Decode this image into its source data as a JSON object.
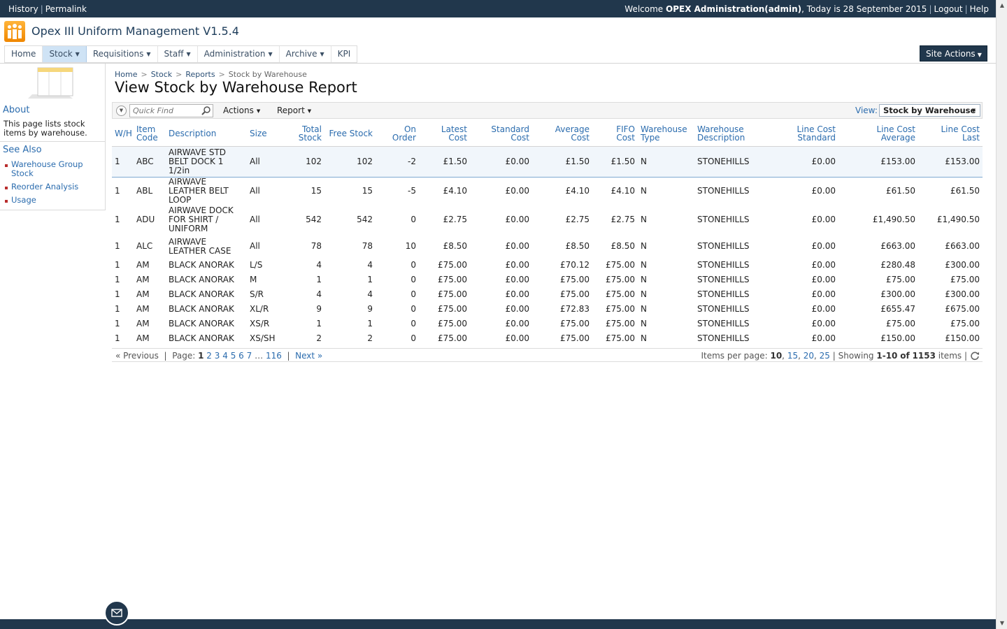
{
  "topbar": {
    "history": "History",
    "permalink": "Permalink",
    "welcome_prefix": "Welcome",
    "user": "OPEX Administration(admin)",
    "today": ", Today is 28 September 2015",
    "logout": "Logout",
    "help": "Help"
  },
  "app": {
    "title": "Opex III Uniform Management V1.5.4"
  },
  "nav": {
    "home": "Home",
    "stock": "Stock",
    "requisitions": "Requisitions",
    "staff": "Staff",
    "administration": "Administration",
    "archive": "Archive",
    "kpi": "KPI",
    "site_actions": "Site Actions"
  },
  "sidebar": {
    "about_title": "About",
    "about_text": "This page lists stock items by warehouse.",
    "see_also_title": "See Also",
    "links": [
      "Warehouse Group Stock",
      "Reorder Analysis",
      "Usage"
    ]
  },
  "breadcrumb": {
    "home": "Home",
    "stock": "Stock",
    "reports": "Reports",
    "current": "Stock by Warehouse"
  },
  "page": {
    "title": "View Stock by Warehouse Report"
  },
  "toolbar": {
    "quick_find_placeholder": "Quick Find",
    "actions": "Actions",
    "report": "Report",
    "view_label": "View:",
    "view_value": "Stock by Warehouse"
  },
  "table": {
    "headers": [
      "W/H",
      "Item Code",
      "Description",
      "Size",
      "Total Stock",
      "Free Stock",
      "On Order",
      "Latest Cost",
      "Standard Cost",
      "Average Cost",
      "FIFO Cost",
      "Warehouse Type",
      "Warehouse Description",
      "Line Cost Standard",
      "Line Cost Average",
      "Line Cost Last"
    ],
    "rows": [
      [
        "1",
        "ABC",
        "AIRWAVE STD BELT DOCK 1 1/2in",
        "All",
        "102",
        "102",
        "-2",
        "£1.50",
        "£0.00",
        "£1.50",
        "£1.50",
        "N",
        "STONEHILLS",
        "£0.00",
        "£153.00",
        "£153.00"
      ],
      [
        "1",
        "ABL",
        "AIRWAVE LEATHER BELT LOOP",
        "All",
        "15",
        "15",
        "-5",
        "£4.10",
        "£0.00",
        "£4.10",
        "£4.10",
        "N",
        "STONEHILLS",
        "£0.00",
        "£61.50",
        "£61.50"
      ],
      [
        "1",
        "ADU",
        "AIRWAVE DOCK FOR SHIRT / UNIFORM",
        "All",
        "542",
        "542",
        "0",
        "£2.75",
        "£0.00",
        "£2.75",
        "£2.75",
        "N",
        "STONEHILLS",
        "£0.00",
        "£1,490.50",
        "£1,490.50"
      ],
      [
        "1",
        "ALC",
        "AIRWAVE LEATHER CASE",
        "All",
        "78",
        "78",
        "10",
        "£8.50",
        "£0.00",
        "£8.50",
        "£8.50",
        "N",
        "STONEHILLS",
        "£0.00",
        "£663.00",
        "£663.00"
      ],
      [
        "1",
        "AM",
        "BLACK ANORAK",
        "L/S",
        "4",
        "4",
        "0",
        "£75.00",
        "£0.00",
        "£70.12",
        "£75.00",
        "N",
        "STONEHILLS",
        "£0.00",
        "£280.48",
        "£300.00"
      ],
      [
        "1",
        "AM",
        "BLACK ANORAK",
        "M",
        "1",
        "1",
        "0",
        "£75.00",
        "£0.00",
        "£75.00",
        "£75.00",
        "N",
        "STONEHILLS",
        "£0.00",
        "£75.00",
        "£75.00"
      ],
      [
        "1",
        "AM",
        "BLACK ANORAK",
        "S/R",
        "4",
        "4",
        "0",
        "£75.00",
        "£0.00",
        "£75.00",
        "£75.00",
        "N",
        "STONEHILLS",
        "£0.00",
        "£300.00",
        "£300.00"
      ],
      [
        "1",
        "AM",
        "BLACK ANORAK",
        "XL/R",
        "9",
        "9",
        "0",
        "£75.00",
        "£0.00",
        "£72.83",
        "£75.00",
        "N",
        "STONEHILLS",
        "£0.00",
        "£655.47",
        "£675.00"
      ],
      [
        "1",
        "AM",
        "BLACK ANORAK",
        "XS/R",
        "1",
        "1",
        "0",
        "£75.00",
        "£0.00",
        "£75.00",
        "£75.00",
        "N",
        "STONEHILLS",
        "£0.00",
        "£75.00",
        "£75.00"
      ],
      [
        "1",
        "AM",
        "BLACK ANORAK",
        "XS/SH",
        "2",
        "2",
        "0",
        "£75.00",
        "£0.00",
        "£75.00",
        "£75.00",
        "N",
        "STONEHILLS",
        "£0.00",
        "£150.00",
        "£150.00"
      ]
    ]
  },
  "pager": {
    "previous": "« Previous",
    "page_label": "Page:",
    "current_page": "1",
    "pages": [
      "2",
      "3",
      "4",
      "5",
      "6",
      "7"
    ],
    "ellipsis": "…",
    "last_page": "116",
    "next": "Next »",
    "items_per_page_label": "Items per page:",
    "per_page_current": "10",
    "per_page_options": [
      "15",
      "20",
      "25"
    ],
    "showing_label": "Showing",
    "range": "1-10",
    "of": "of",
    "total": "1153",
    "items_label": "items"
  },
  "icons": {
    "logo": "people-logo-icon",
    "page": "report-page-icon",
    "quick_find_toggle": "chevron-down-circle-icon",
    "search": "search-icon",
    "refresh": "refresh-icon",
    "mail": "envelope-icon"
  },
  "colors": {
    "topbar": "#21374c",
    "link": "#2b6cae",
    "logo_orange": "#f08700",
    "selected_row": "#f1f6fb",
    "bullet": "#b92d2d"
  }
}
